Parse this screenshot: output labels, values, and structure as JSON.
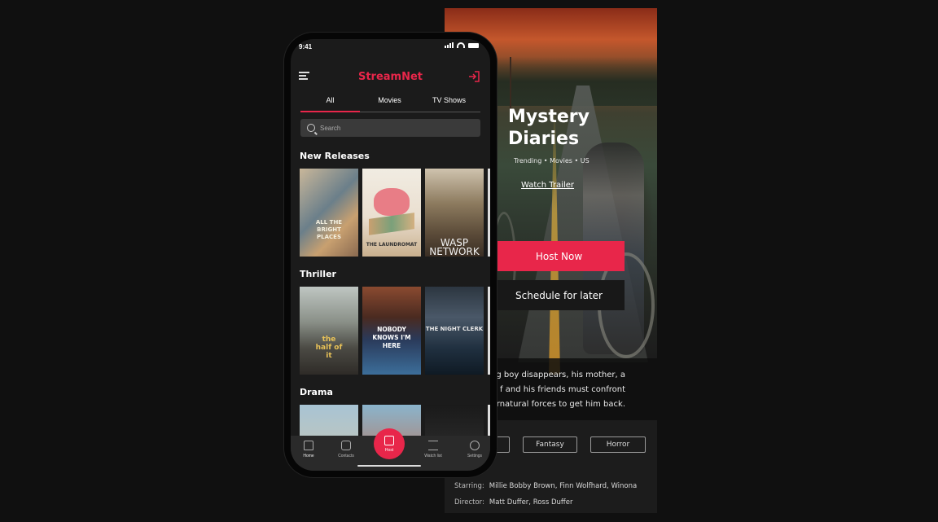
{
  "status_bar": {
    "time": "9:41"
  },
  "app": {
    "brand": "StreamNet"
  },
  "tabs": [
    {
      "label": "All",
      "active": true
    },
    {
      "label": "Movies",
      "active": false
    },
    {
      "label": "TV Shows",
      "active": false
    }
  ],
  "search": {
    "placeholder": "Search"
  },
  "sections": [
    {
      "title": "New Releases",
      "posters": [
        {
          "text": "ALL THE BRIGHT PLACES"
        },
        {
          "text": "THE LAUNDROMAT"
        },
        {
          "text": "WASP NETWORK"
        }
      ]
    },
    {
      "title": "Thriller",
      "posters": [
        {
          "text": "the half of it"
        },
        {
          "text": "NOBODY KNOWS I'M HERE"
        },
        {
          "text": "THE NIGHT CLERK"
        }
      ]
    },
    {
      "title": "Drama",
      "posters": [
        {
          "text": ""
        },
        {
          "text": ""
        },
        {
          "text": ""
        }
      ]
    }
  ],
  "bottom_nav": [
    {
      "label": "Home",
      "icon": "home-icon"
    },
    {
      "label": "Contacts",
      "icon": "contacts-icon"
    },
    {
      "label": "Host",
      "icon": "host-icon"
    },
    {
      "label": "Watch list",
      "icon": "watchlist-icon"
    },
    {
      "label": "Settings",
      "icon": "settings-icon"
    }
  ],
  "detail": {
    "title_line1": "Mystery",
    "title_line2": "Diaries",
    "meta": "Trending • Movies • US",
    "watch_trailer": "Watch Trailer",
    "host_now": "Host Now",
    "schedule": "Schedule for later",
    "synopsis_lines": [
      "ung boy disappears, his mother, a",
      "f and his friends must confront",
      "upernatural forces to get him back."
    ],
    "genres": [
      "Fantasy",
      "Horror"
    ],
    "starring_label": "Starring:",
    "starring_value": "Millie Bobby Brown, Finn Wolfhard, Winona",
    "director_label": "Director:",
    "director_value": "Matt Duffer, Ross Duffer"
  },
  "colors": {
    "accent": "#e8264a",
    "background": "#101010",
    "surface": "#1b1b1b"
  }
}
